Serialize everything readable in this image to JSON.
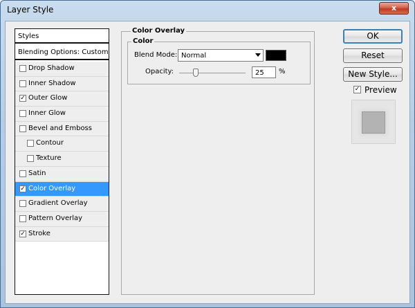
{
  "window": {
    "title": "Layer Style",
    "close_label": "x"
  },
  "styles_panel": {
    "header": "Styles",
    "blending_options": "Blending Options: Custom",
    "items": [
      {
        "label": "Drop Shadow",
        "checked": false,
        "indent": false,
        "selected": false
      },
      {
        "label": "Inner Shadow",
        "checked": false,
        "indent": false,
        "selected": false
      },
      {
        "label": "Outer Glow",
        "checked": true,
        "indent": false,
        "selected": false
      },
      {
        "label": "Inner Glow",
        "checked": false,
        "indent": false,
        "selected": false
      },
      {
        "label": "Bevel and Emboss",
        "checked": false,
        "indent": false,
        "selected": false
      },
      {
        "label": "Contour",
        "checked": false,
        "indent": true,
        "selected": false
      },
      {
        "label": "Texture",
        "checked": false,
        "indent": true,
        "selected": false
      },
      {
        "label": "Satin",
        "checked": false,
        "indent": false,
        "selected": false
      },
      {
        "label": "Color Overlay",
        "checked": true,
        "indent": false,
        "selected": true
      },
      {
        "label": "Gradient Overlay",
        "checked": false,
        "indent": false,
        "selected": false
      },
      {
        "label": "Pattern Overlay",
        "checked": false,
        "indent": false,
        "selected": false
      },
      {
        "label": "Stroke",
        "checked": true,
        "indent": false,
        "selected": false
      }
    ]
  },
  "color_overlay": {
    "group_title": "Color Overlay",
    "subgroup_title": "Color",
    "blend_mode_label": "Blend Mode:",
    "blend_mode_value": "Normal",
    "swatch_color": "#000000",
    "opacity_label": "Opacity:",
    "opacity_value": "25",
    "opacity_unit": "%",
    "opacity_fraction": 0.25
  },
  "buttons": {
    "ok": "OK",
    "reset": "Reset",
    "new_style": "New Style...",
    "preview_label": "Preview",
    "preview_checked": true
  },
  "check_glyph": "✓"
}
